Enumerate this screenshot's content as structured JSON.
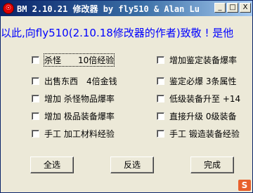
{
  "window": {
    "title": "BM 2.10.21 修改器 by fly510 & Alan Lu",
    "icon": "bm-app-icon",
    "title_buttons": {
      "minimize": "_",
      "maximize": "□",
      "close": "X"
    }
  },
  "banner": {
    "text": "以此,向fly510(2.10.18修改器的作者)致敬 ! 是他"
  },
  "options": {
    "left": [
      {
        "label": "杀怪　　10倍经验",
        "checked": false
      },
      {
        "label": "出售东西　4倍金钱",
        "checked": false
      },
      {
        "label": "增加 杀怪物品爆率",
        "checked": false
      },
      {
        "label": "增加 极品装备爆率",
        "checked": false
      },
      {
        "label": "手工 加工材料经验",
        "checked": false
      }
    ],
    "right": [
      {
        "label": "增加鉴定装备爆率",
        "checked": false
      },
      {
        "label": "鉴定必爆 3条属性",
        "checked": false
      },
      {
        "label": "低级装备升至 +14",
        "checked": false
      },
      {
        "label": "直接升级 0级装备",
        "checked": false
      },
      {
        "label": "手工 锻造装备经验",
        "checked": false
      }
    ]
  },
  "buttons": {
    "select_all": "全选",
    "invert": "反选",
    "done": "完成"
  },
  "corner_logo": {
    "text": "S",
    "icon": "brand-logo-icon",
    "color": "#e8602c"
  }
}
